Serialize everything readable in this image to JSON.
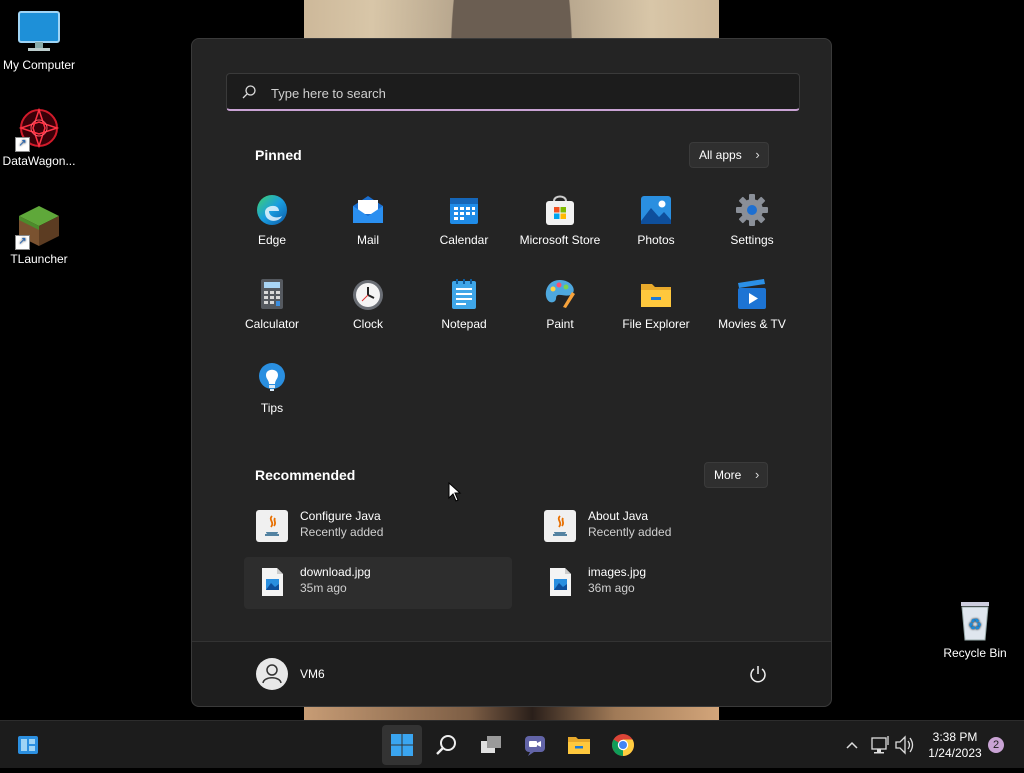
{
  "desktop": {
    "icons": [
      {
        "label": "My Computer",
        "icon": "monitor-icon"
      },
      {
        "label": "DataWagon...",
        "icon": "datawagon-icon"
      },
      {
        "label": "TLauncher",
        "icon": "grass-block-icon"
      },
      {
        "label": "Recycle Bin",
        "icon": "recycle-bin-icon"
      }
    ]
  },
  "start_menu": {
    "search": {
      "placeholder": "Type here to search",
      "value": ""
    },
    "pinned": {
      "title": "Pinned",
      "all_apps_label": "All apps",
      "apps": [
        {
          "label": "Edge",
          "icon": "edge-icon"
        },
        {
          "label": "Mail",
          "icon": "mail-icon"
        },
        {
          "label": "Calendar",
          "icon": "calendar-icon"
        },
        {
          "label": "Microsoft Store",
          "icon": "store-icon"
        },
        {
          "label": "Photos",
          "icon": "photos-icon"
        },
        {
          "label": "Settings",
          "icon": "gear-icon"
        },
        {
          "label": "Calculator",
          "icon": "calculator-icon"
        },
        {
          "label": "Clock",
          "icon": "clock-icon"
        },
        {
          "label": "Notepad",
          "icon": "notepad-icon"
        },
        {
          "label": "Paint",
          "icon": "paint-icon"
        },
        {
          "label": "File Explorer",
          "icon": "folder-icon"
        },
        {
          "label": "Movies & TV",
          "icon": "movies-icon"
        },
        {
          "label": "Tips",
          "icon": "lightbulb-icon"
        }
      ]
    },
    "recommended": {
      "title": "Recommended",
      "more_label": "More",
      "items": [
        {
          "name": "Configure Java",
          "subtitle": "Recently added",
          "icon": "java-icon"
        },
        {
          "name": "About Java",
          "subtitle": "Recently added",
          "icon": "java-icon"
        },
        {
          "name": "download.jpg",
          "subtitle": "35m ago",
          "icon": "image-file-icon"
        },
        {
          "name": "images.jpg",
          "subtitle": "36m ago",
          "icon": "image-file-icon"
        }
      ]
    },
    "user": {
      "name": "VM6"
    }
  },
  "taskbar": {
    "buttons": [
      "start-icon",
      "search-icon",
      "task-view-icon",
      "chat-icon",
      "file-explorer-icon",
      "chrome-icon"
    ],
    "clock": {
      "time": "3:38 PM",
      "date": "1/24/2023"
    },
    "notification_count": "2"
  },
  "colors": {
    "accent": "#c9a3d4",
    "panel": "#242424",
    "taskbar": "#1c1c1c"
  }
}
